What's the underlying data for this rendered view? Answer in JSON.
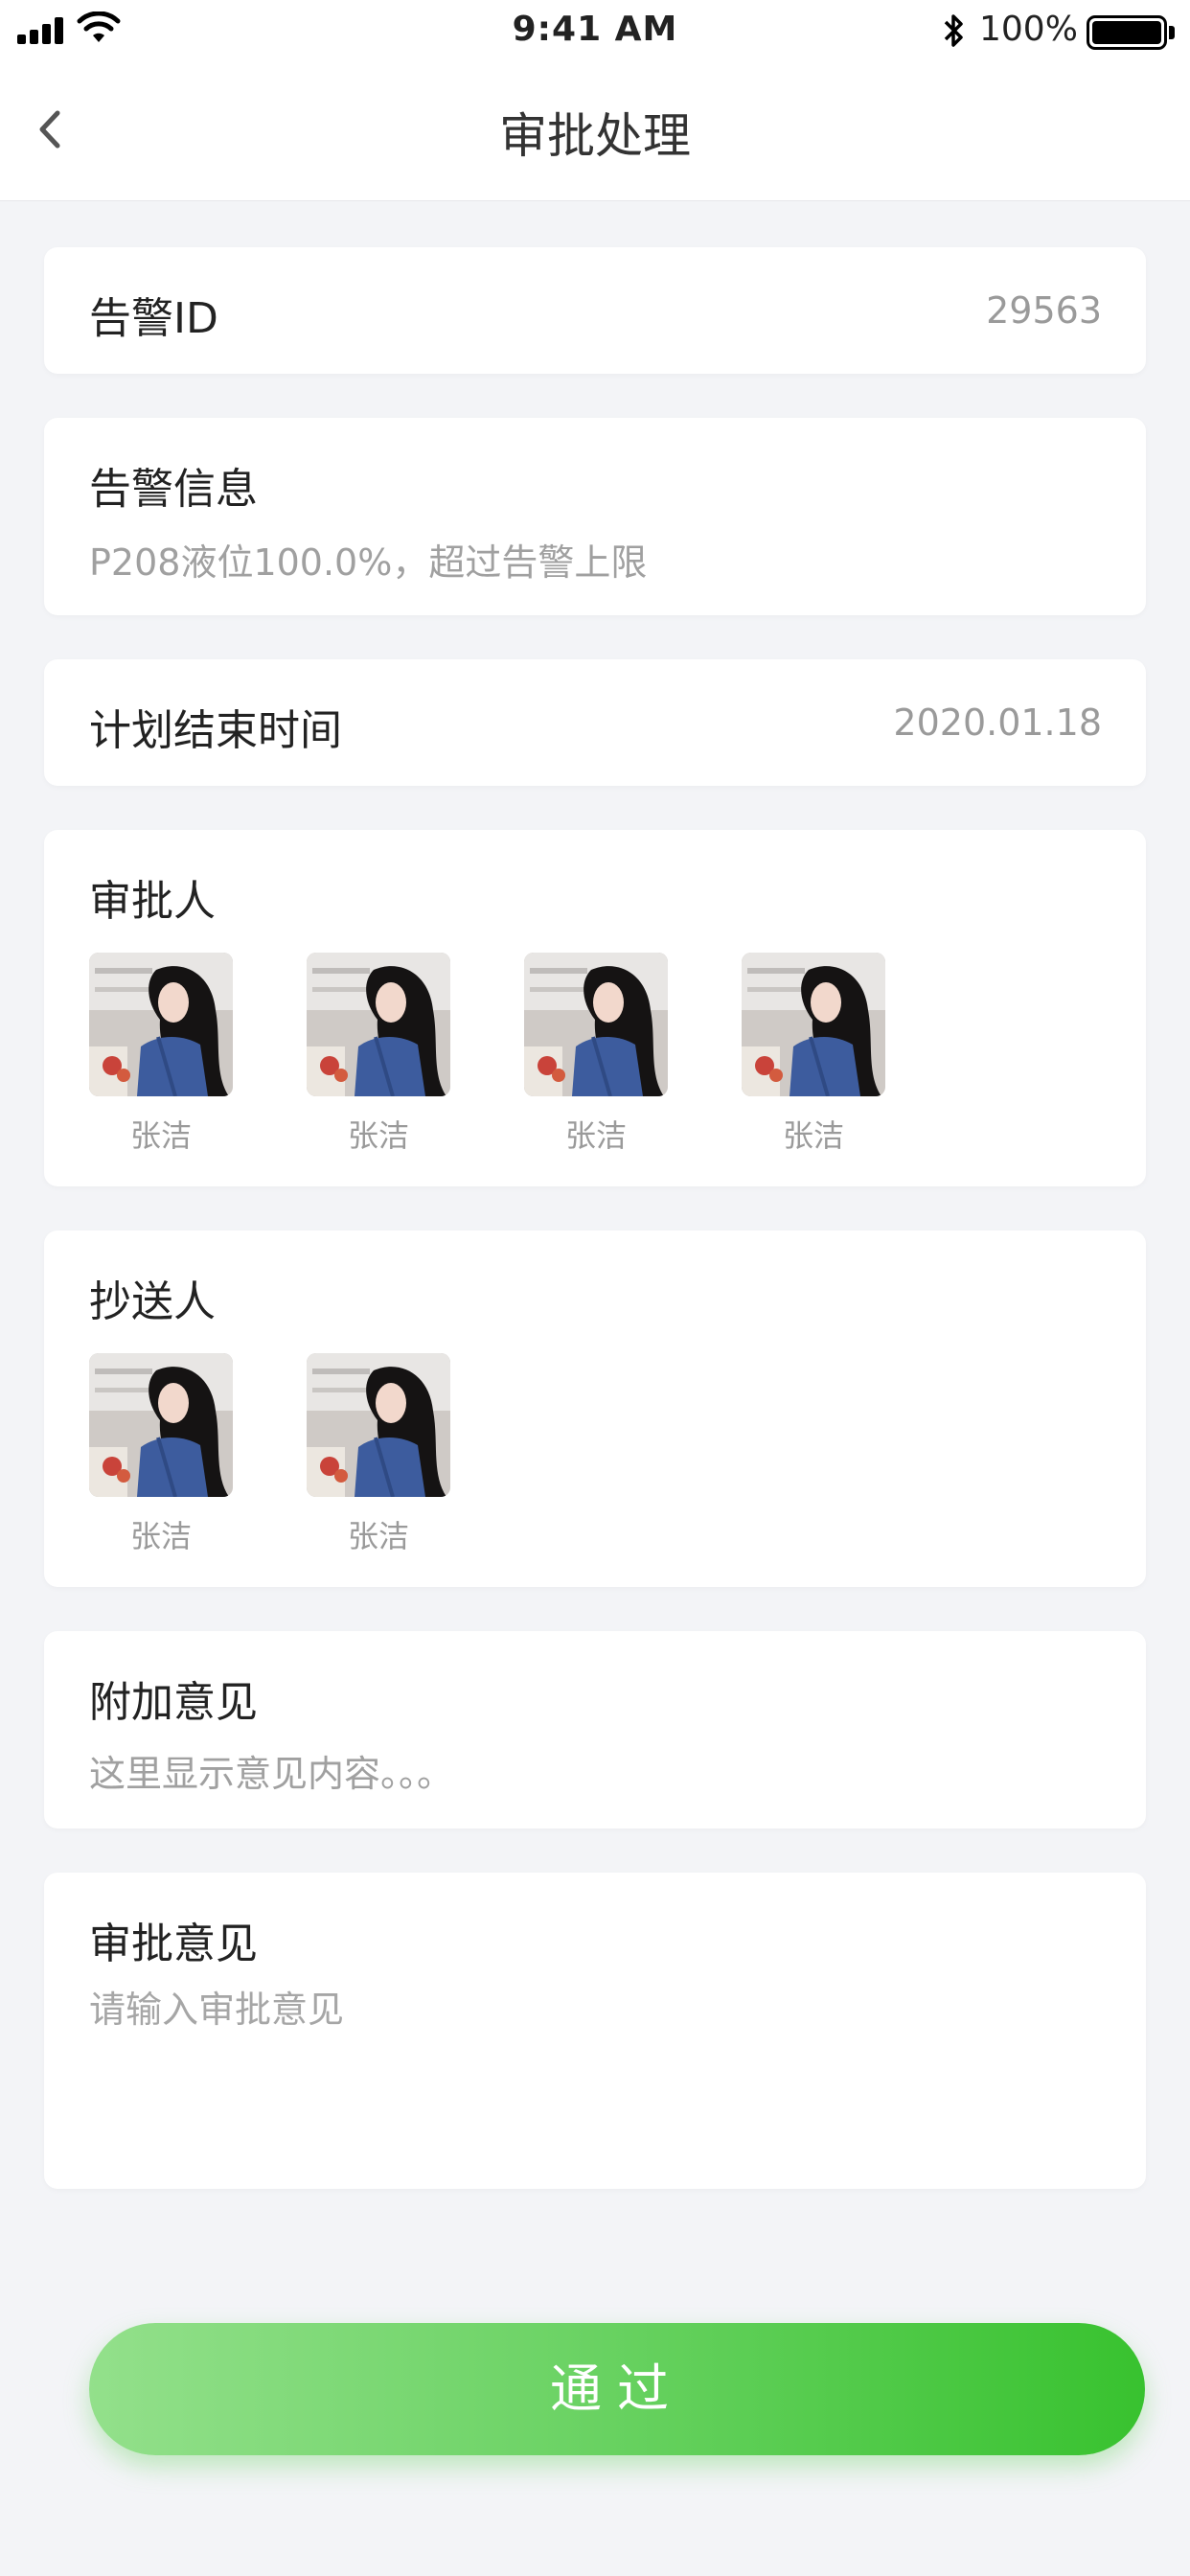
{
  "status_bar": {
    "time": "9:41 AM",
    "battery_percent": "100%",
    "icons": [
      "signal-icon",
      "wifi-icon",
      "bluetooth-icon",
      "battery-icon"
    ]
  },
  "nav": {
    "title": "审批处理",
    "back_icon": "chevron-left-icon"
  },
  "alarm_id": {
    "label": "告警ID",
    "value": "29563"
  },
  "alarm_info": {
    "label": "告警信息",
    "text": "P208液位100.0%，超过告警上限"
  },
  "planned_end": {
    "label": "计划结束时间",
    "value": "2020.01.18"
  },
  "approvers": {
    "label": "审批人",
    "people": [
      {
        "name": "张洁"
      },
      {
        "name": "张洁"
      },
      {
        "name": "张洁"
      },
      {
        "name": "张洁"
      }
    ]
  },
  "cc": {
    "label": "抄送人",
    "people": [
      {
        "name": "张洁"
      },
      {
        "name": "张洁"
      }
    ]
  },
  "extra_opinion": {
    "label": "附加意见",
    "text": "这里显示意见内容。。。"
  },
  "approval_opinion": {
    "label": "审批意见",
    "placeholder": "请输入审批意见"
  },
  "submit": {
    "label": "通过"
  },
  "colors": {
    "accent_start": "#93e08b",
    "accent_end": "#38c22f",
    "background": "#f3f4f7"
  }
}
